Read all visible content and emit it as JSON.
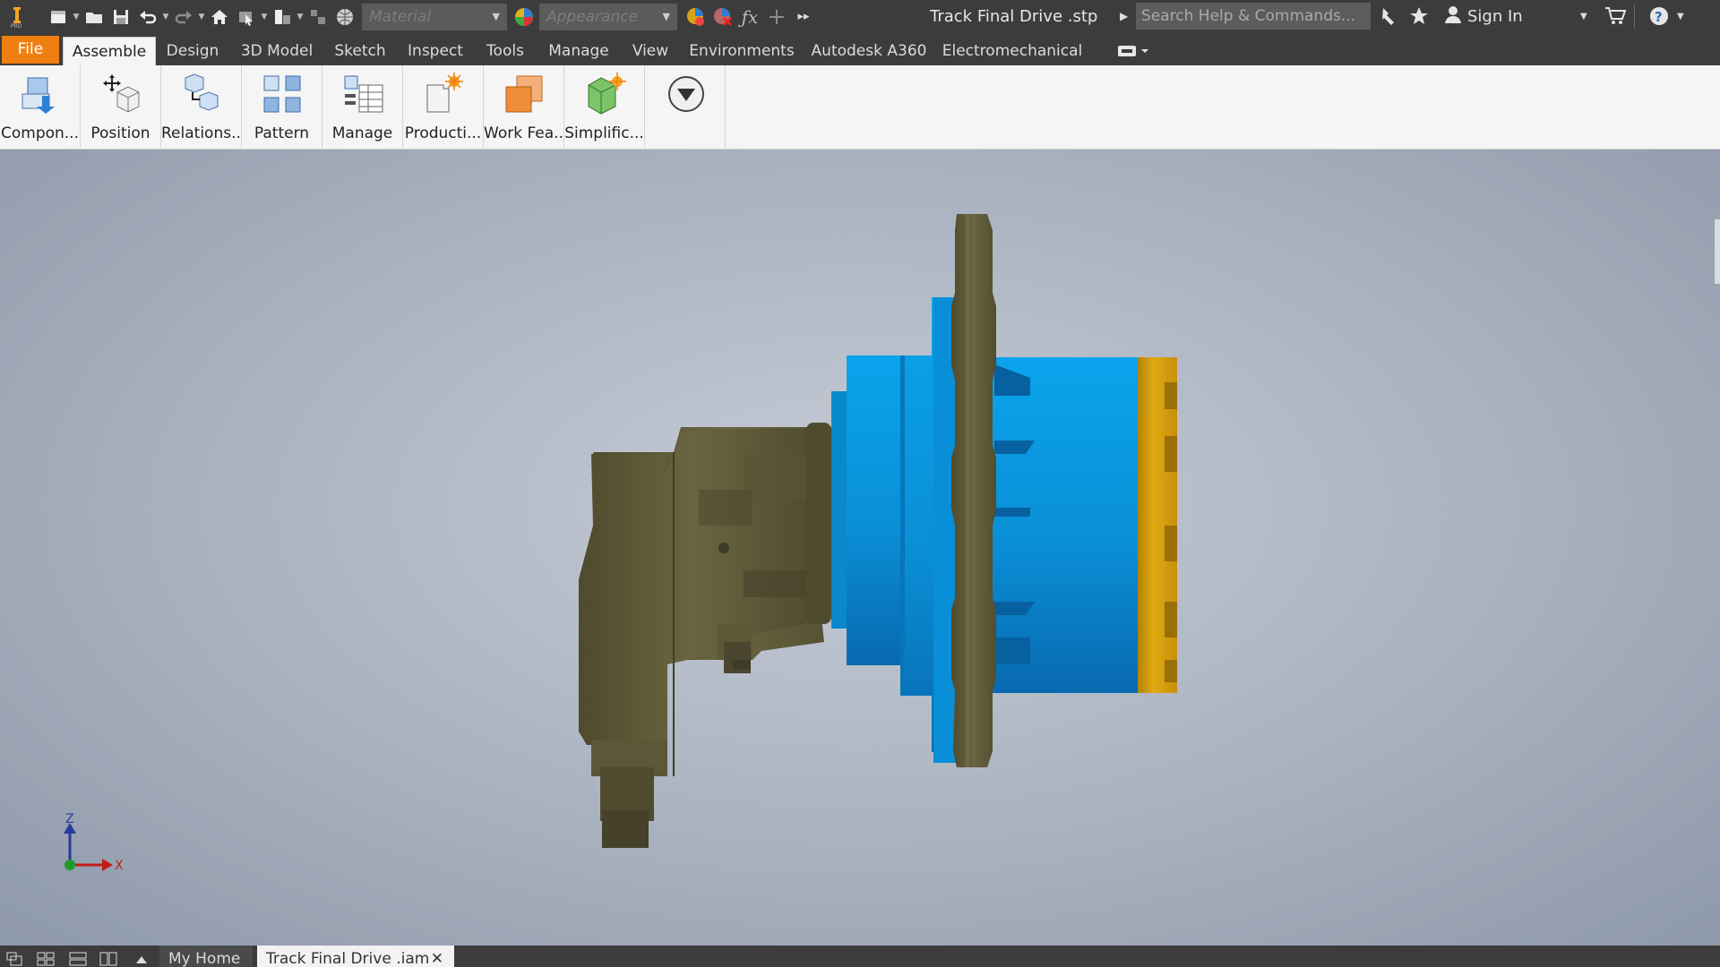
{
  "quick_access": {
    "material_placeholder": "Material",
    "appearance_placeholder": "Appearance",
    "document_title": "Track Final Drive .stp",
    "search_placeholder": "Search Help & Commands...",
    "sign_in": "Sign In"
  },
  "ribbon_tabs": [
    {
      "label": "File"
    },
    {
      "label": "Assemble"
    },
    {
      "label": "Design"
    },
    {
      "label": "3D Model"
    },
    {
      "label": "Sketch"
    },
    {
      "label": "Inspect"
    },
    {
      "label": "Tools"
    },
    {
      "label": "Manage"
    },
    {
      "label": "View"
    },
    {
      "label": "Environments"
    },
    {
      "label": "Autodesk A360"
    },
    {
      "label": "Electromechanical"
    }
  ],
  "active_tab": "Assemble",
  "ribbon_panels": [
    {
      "label": "Compon..."
    },
    {
      "label": "Position"
    },
    {
      "label": "Relations..."
    },
    {
      "label": "Pattern"
    },
    {
      "label": "Manage"
    },
    {
      "label": "Producti..."
    },
    {
      "label": "Work Fea..."
    },
    {
      "label": "Simplific..."
    }
  ],
  "viewport": {
    "triad": {
      "z_label": "Z",
      "x_label": "X"
    },
    "colors": {
      "housing_blue": "#0a8fd6",
      "cap_gold": "#d9a20f",
      "motor_olive": "#5e5a38"
    }
  },
  "document_tabs": [
    {
      "label": "My Home"
    },
    {
      "label": "Track Final Drive .iam"
    }
  ]
}
